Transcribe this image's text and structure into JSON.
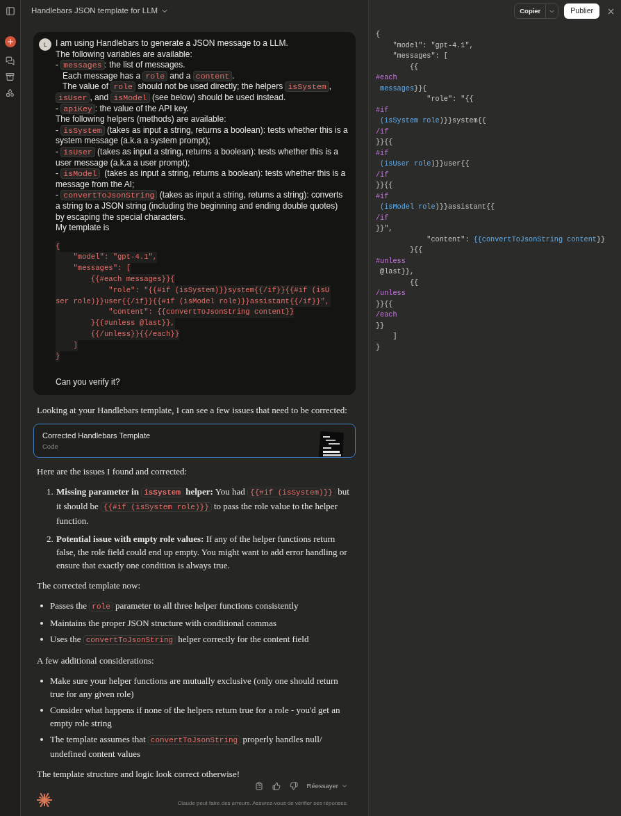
{
  "header": {
    "title": "Handlebars JSON template for LLM"
  },
  "toolbar": {
    "copy_label": "Copier",
    "publish_label": "Publier"
  },
  "user_message": {
    "avatar": "L",
    "lines": [
      [
        {
          "kind": "text",
          "text": "I am using Handlebars to generate a JSON message to a LLM."
        }
      ],
      [
        {
          "kind": "text",
          "text": "The following variables are available:"
        }
      ],
      [
        {
          "kind": "text",
          "text": "- "
        },
        {
          "kind": "code",
          "text": "messages"
        },
        {
          "kind": "text",
          "text": ": the list of messages."
        }
      ],
      [
        {
          "kind": "text",
          "text": "   Each message has a "
        },
        {
          "kind": "code",
          "text": "role"
        },
        {
          "kind": "text",
          "text": " and a "
        },
        {
          "kind": "code",
          "text": "content"
        },
        {
          "kind": "text",
          "text": "."
        }
      ],
      [
        {
          "kind": "text",
          "text": "   The value of "
        },
        {
          "kind": "code",
          "text": "role"
        },
        {
          "kind": "text",
          "text": " should not be used directly; the helpers "
        },
        {
          "kind": "code",
          "text": "isSystem"
        },
        {
          "kind": "text",
          "text": ", "
        },
        {
          "kind": "code",
          "text": "isUser"
        },
        {
          "kind": "text",
          "text": ", and "
        },
        {
          "kind": "code",
          "text": "isModel"
        },
        {
          "kind": "text",
          "text": " (see below) should be used instead."
        }
      ],
      [
        {
          "kind": "text",
          "text": "- "
        },
        {
          "kind": "code",
          "text": "apiKey"
        },
        {
          "kind": "text",
          "text": ": the value of the API key."
        }
      ],
      [
        {
          "kind": "text",
          "text": "The following helpers (methods) are available:"
        }
      ],
      [
        {
          "kind": "text",
          "text": "- "
        },
        {
          "kind": "code",
          "text": "isSystem"
        },
        {
          "kind": "text",
          "text": " (takes as input a string, returns a boolean): tests whether this is a system message (a.k.a a system prompt);"
        }
      ],
      [
        {
          "kind": "text",
          "text": "- "
        },
        {
          "kind": "code",
          "text": "isUser"
        },
        {
          "kind": "text",
          "text": " (takes as input a string, returns a boolean): tests whether this is a user message (a.k.a a user prompt);"
        }
      ],
      [
        {
          "kind": "text",
          "text": "- "
        },
        {
          "kind": "code",
          "text": "isModel"
        },
        {
          "kind": "text",
          "text": "  (takes as input a string, returns a boolean): tests whether this is a message from the AI;"
        }
      ],
      [
        {
          "kind": "text",
          "text": "- "
        },
        {
          "kind": "code",
          "text": "convertToJsonString"
        },
        {
          "kind": "text",
          "text": " (takes as input a string, returns a string): converts a string to a JSON string (including the beginning and ending double quotes) by escaping the special characters."
        }
      ],
      [
        {
          "kind": "text",
          "text": "My template is"
        }
      ]
    ],
    "code_block": [
      "{",
      "    \"model\": \"gpt-4.1\",",
      "    \"messages\": [",
      "        {{#each messages}}{",
      "            \"role\": \"{{#if (isSystem)}}system{{/if}}{{#if (isUser role)}}user{{/if}}{{#if (isModel role)}}assistant{{/if}}\",",
      "            \"content\": {{convertToJsonString content}}",
      "        }{{#unless @last}},",
      "        {{/unless}}{{/each}}",
      "    ]",
      "}"
    ],
    "closing": "Can you verify it?"
  },
  "assistant_message": {
    "blocks": [
      {
        "kind": "paragraph",
        "items": [
          [
            {
              "kind": "text",
              "text": "Looking at your Handlebars template, I can see a few issues that need to be corrected:"
            }
          ]
        ]
      },
      {
        "kind": "artifact",
        "title": "Corrected Handlebars Template",
        "subtitle": "Code"
      },
      {
        "kind": "paragraph",
        "items": [
          [
            {
              "kind": "text",
              "text": "Here are the issues I found and corrected:"
            }
          ]
        ]
      },
      {
        "kind": "numbered_list",
        "items": [
          {
            "number": "1.",
            "segments": [
              {
                "kind": "bold",
                "text": "Missing parameter in "
              },
              {
                "kind": "bold_code",
                "text": "isSystem"
              },
              {
                "kind": "bold",
                "text": " helper:"
              },
              {
                "kind": "text",
                "text": " You had "
              },
              {
                "kind": "code",
                "text": "{{#if (isSystem)}}"
              },
              {
                "kind": "text",
                "text": " but it should be "
              },
              {
                "kind": "code",
                "text": "{{#if (isSystem role)}}"
              },
              {
                "kind": "text",
                "text": " to pass the role value to the helper function."
              }
            ]
          },
          {
            "number": "2.",
            "segments": [
              {
                "kind": "bold",
                "text": "Potential issue with empty role values:"
              },
              {
                "kind": "text",
                "text": " If any of the helper functions return false, the role field could end up empty. You might want to add error handling or ensure that exactly one condition is always true."
              }
            ]
          }
        ]
      },
      {
        "kind": "paragraph",
        "items": [
          [
            {
              "kind": "text",
              "text": "The corrected template now:"
            }
          ]
        ]
      },
      {
        "kind": "bullet_list",
        "items": [
          [
            {
              "kind": "text",
              "text": "Passes the "
            },
            {
              "kind": "code",
              "text": "role"
            },
            {
              "kind": "text",
              "text": " parameter to all three helper functions consistently"
            }
          ],
          [
            {
              "kind": "text",
              "text": "Maintains the proper JSON structure with conditional commas"
            }
          ],
          [
            {
              "kind": "text",
              "text": "Uses the "
            },
            {
              "kind": "code",
              "text": "convertToJsonString"
            },
            {
              "kind": "text",
              "text": " helper correctly for the content field"
            }
          ]
        ]
      },
      {
        "kind": "paragraph",
        "items": [
          [
            {
              "kind": "text",
              "text": "A few additional considerations:"
            }
          ]
        ]
      },
      {
        "kind": "bullet_list",
        "items": [
          [
            {
              "kind": "text",
              "text": "Make sure your helper functions are mutually exclusive (only one should return true for any given role)"
            }
          ],
          [
            {
              "kind": "text",
              "text": "Consider what happens if none of the helpers return true for a role - you'd get an empty role string"
            }
          ],
          [
            {
              "kind": "text",
              "text": "The template assumes that "
            },
            {
              "kind": "code",
              "text": "convertToJsonString"
            },
            {
              "kind": "text",
              "text": " properly handles null/ undefined content values"
            }
          ]
        ]
      },
      {
        "kind": "paragraph",
        "items": [
          [
            {
              "kind": "text",
              "text": "The template structure and logic look correct otherwise!"
            }
          ]
        ]
      }
    ],
    "retry_label": "Réessayer",
    "disclaimer": "Claude peut faire des erreurs. Assurez-vous de vérifier ses réponses."
  },
  "artifact_code": [
    [
      {
        "kind": "plain",
        "text": "{"
      }
    ],
    [
      {
        "kind": "plain",
        "text": "    \"model\": \"gpt-4.1\","
      }
    ],
    [
      {
        "kind": "plain",
        "text": "    \"messages\": ["
      }
    ],
    [
      {
        "kind": "plain",
        "text": "        {{"
      }
    ],
    [
      {
        "kind": "keyword",
        "text": "#each"
      }
    ],
    [
      {
        "kind": "name",
        "text": " messages"
      },
      {
        "kind": "plain",
        "text": "}}{"
      }
    ],
    [
      {
        "kind": "plain",
        "text": "            \"role\": \"{{"
      }
    ],
    [
      {
        "kind": "keyword",
        "text": "#if"
      }
    ],
    [
      {
        "kind": "name",
        "text": " (isSystem role"
      },
      {
        "kind": "plain",
        "text": ")}}system{{"
      }
    ],
    [
      {
        "kind": "keyword",
        "text": "/if"
      }
    ],
    [
      {
        "kind": "plain",
        "text": "}}{{"
      }
    ],
    [
      {
        "kind": "keyword",
        "text": "#if"
      }
    ],
    [
      {
        "kind": "name",
        "text": " (isUser role"
      },
      {
        "kind": "plain",
        "text": ")}}user{{"
      }
    ],
    [
      {
        "kind": "keyword",
        "text": "/if"
      }
    ],
    [
      {
        "kind": "plain",
        "text": "}}{{"
      }
    ],
    [
      {
        "kind": "keyword",
        "text": "#if"
      }
    ],
    [
      {
        "kind": "name",
        "text": " (isModel role"
      },
      {
        "kind": "plain",
        "text": ")}}assistant{{"
      }
    ],
    [
      {
        "kind": "keyword",
        "text": "/if"
      }
    ],
    [
      {
        "kind": "plain",
        "text": "}}\","
      }
    ],
    [
      {
        "kind": "plain",
        "text": "            \"content\": "
      },
      {
        "kind": "name",
        "text": "{{convertToJsonString content"
      },
      {
        "kind": "plain",
        "text": "}}"
      }
    ],
    [
      {
        "kind": "plain",
        "text": "        }{{"
      }
    ],
    [
      {
        "kind": "keyword",
        "text": "#unless"
      }
    ],
    [
      {
        "kind": "plain",
        "text": " @last}},"
      }
    ],
    [
      {
        "kind": "plain",
        "text": "        {{"
      }
    ],
    [
      {
        "kind": "keyword",
        "text": "/unless"
      }
    ],
    [
      {
        "kind": "plain",
        "text": "}}{{"
      }
    ],
    [
      {
        "kind": "keyword",
        "text": "/each"
      }
    ],
    [
      {
        "kind": "plain",
        "text": "}}"
      }
    ],
    [
      {
        "kind": "plain",
        "text": "    ]"
      }
    ],
    [
      {
        "kind": "plain",
        "text": "}"
      }
    ]
  ]
}
